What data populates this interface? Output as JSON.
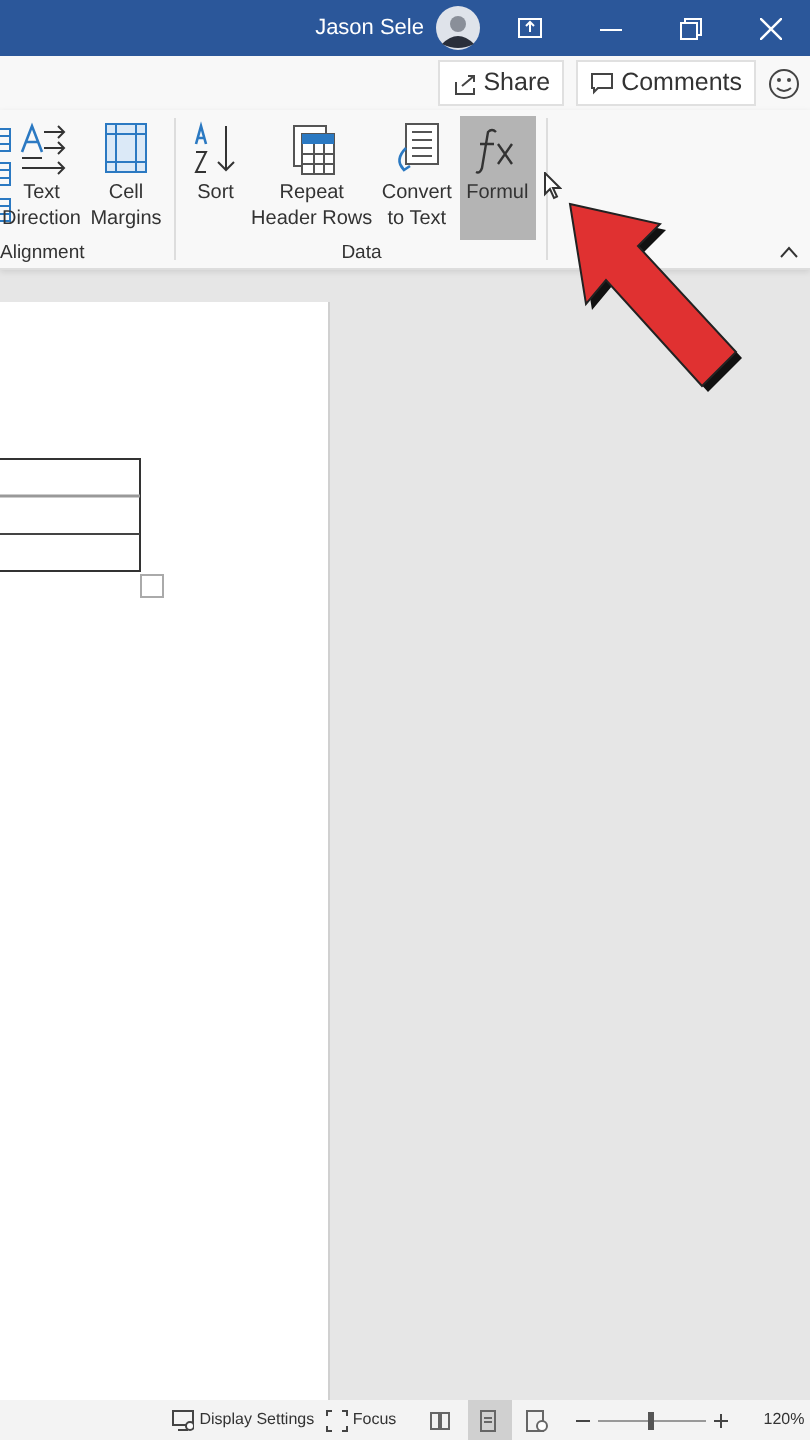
{
  "title_bar": {
    "user_name": "Jason Sele"
  },
  "actions": [
    {
      "kind": "share",
      "label": "Share"
    },
    {
      "kind": "comments",
      "label": "Comments"
    }
  ],
  "ribbon": {
    "groups": [
      {
        "label": "Alignment",
        "buttons": [
          {
            "kind": "text-direction",
            "lines": [
              "Text",
              "Direction"
            ],
            "selected": false
          },
          {
            "kind": "cell-margins",
            "lines": [
              "Cell",
              "Margins"
            ],
            "selected": false
          }
        ]
      },
      {
        "label": "Data",
        "buttons": [
          {
            "kind": "sort",
            "lines": [
              "Sort"
            ],
            "selected": false
          },
          {
            "kind": "repeat-header",
            "lines": [
              "Repeat",
              "Header Rows"
            ],
            "selected": false
          },
          {
            "kind": "convert",
            "lines": [
              "Convert",
              "to Text"
            ],
            "selected": false
          },
          {
            "kind": "formula",
            "lines": [
              "Formul"
            ],
            "selected": true
          }
        ]
      }
    ]
  },
  "status_bar": {
    "items": [
      {
        "kind": "display",
        "label": "Display Settings"
      },
      {
        "kind": "focus",
        "label": "Focus"
      }
    ],
    "views": [
      {
        "kind": "read",
        "selected": false
      },
      {
        "kind": "print",
        "selected": true
      },
      {
        "kind": "web",
        "selected": false
      }
    ],
    "zoom": {
      "level": 0.5,
      "reading": "120%"
    }
  }
}
